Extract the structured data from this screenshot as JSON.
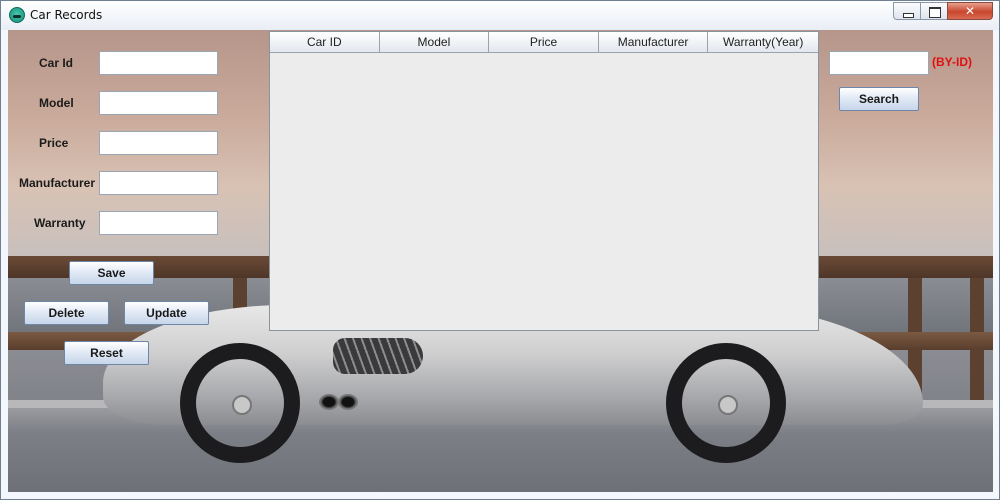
{
  "window": {
    "title": "Car Records"
  },
  "form": {
    "car_id_label": "Car Id",
    "model_label": "Model",
    "price_label": "Price",
    "manufacturer_label": "Manufacturer",
    "warranty_label": "Warranty",
    "car_id_value": "",
    "model_value": "",
    "price_value": "",
    "manufacturer_value": "",
    "warranty_value": ""
  },
  "buttons": {
    "save": "Save",
    "delete": "Delete",
    "update": "Update",
    "reset": "Reset",
    "search": "Search"
  },
  "table": {
    "columns": [
      "Car ID",
      "Model",
      "Price",
      "Manufacturer",
      "Warranty(Year)"
    ],
    "rows": []
  },
  "search": {
    "value": "",
    "hint": "(BY-ID)"
  },
  "colors": {
    "hint_red": "#e01010",
    "table_bg": "#ececec"
  }
}
